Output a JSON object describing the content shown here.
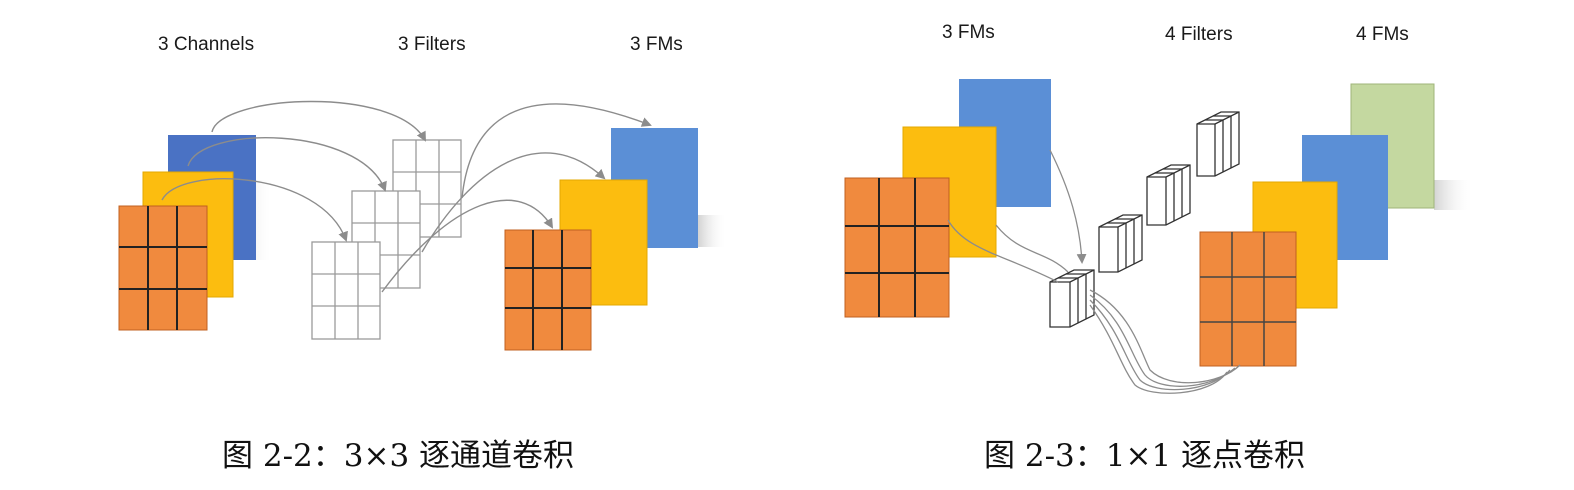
{
  "left": {
    "labels": {
      "channels": "3 Channels",
      "filters": "3 Filters",
      "fms": "3 FMs"
    },
    "caption": "图 2-2：3×3 逐通道卷积"
  },
  "right": {
    "labels": {
      "fms_in": "3 FMs",
      "filters": "4 Filters",
      "fms_out": "4 FMs"
    },
    "caption": "图 2-3：1×1 逐点卷积"
  },
  "colors": {
    "blue": "#4a72c4",
    "blue_light": "#5b8fd6",
    "yellow": "#fcbd0f",
    "orange": "#f08a3e",
    "green": "#c4d8a0",
    "arrow": "#8c8c8c",
    "grid": "#9a9a9a"
  }
}
